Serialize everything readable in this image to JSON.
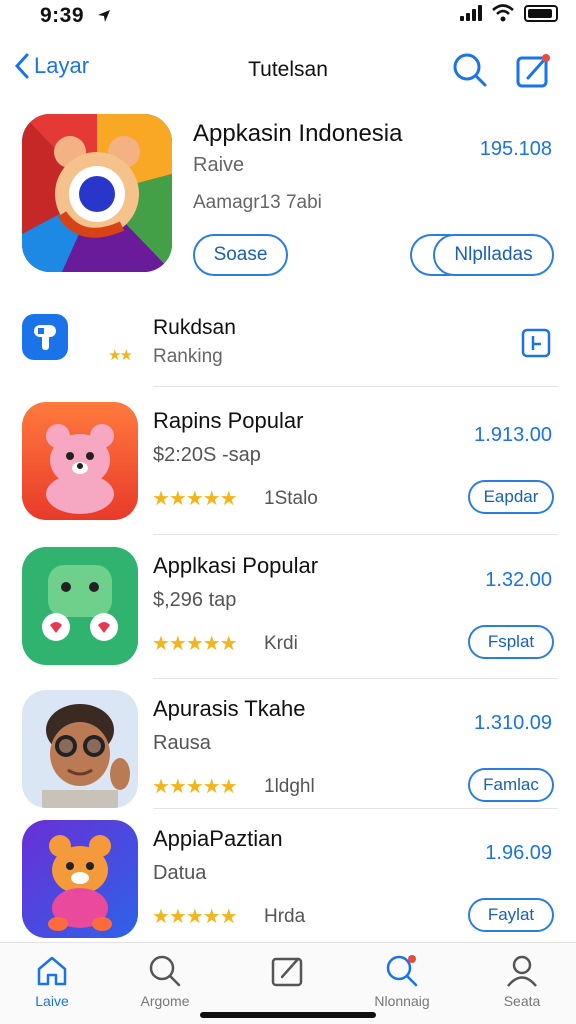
{
  "status_bar": {
    "time": "9:39"
  },
  "nav": {
    "back_label": "Layar",
    "title": "Tutelsan"
  },
  "hero": {
    "name": "Appkasin Indonesia",
    "subtitle": "Raive",
    "developer": "Aamagr13 7abi",
    "price": "195.108",
    "button_primary": "Soase",
    "button_secondary": "Nlplladas"
  },
  "ranking": {
    "title": "Rukdsan",
    "subtitle": "Ranking",
    "stars": "★★"
  },
  "apps": [
    {
      "name": "Rapins Popular",
      "subtitle": "$2:20S -sap",
      "stars": "★★★★★",
      "rating_text": "1Stalo",
      "price": "1.913.00",
      "button": "Eapdar"
    },
    {
      "name": "Applkasi Popular",
      "subtitle": "$,296 tap",
      "stars": "★★★★★",
      "rating_text": "Krdi",
      "price": "1.32.00",
      "button": "Fsplat"
    },
    {
      "name": "Apurasis Tkahe",
      "subtitle": "Rausa",
      "stars": "★★★★★",
      "rating_text": "1ldghl",
      "price": "1.310.09",
      "button": "Famlac"
    },
    {
      "name": "AppiaPaztian",
      "subtitle": "Datua",
      "stars": "★★★★★",
      "rating_text": "Hrda",
      "price": "1.96.09",
      "button": "Faylat"
    }
  ],
  "tabs": [
    {
      "label": "Laive",
      "icon": "home-icon",
      "active": true
    },
    {
      "label": "Argome",
      "icon": "search-icon",
      "active": false
    },
    {
      "label": "",
      "icon": "edit-icon",
      "active": false
    },
    {
      "label": "Nlonnaig",
      "icon": "search-badge-icon",
      "active": false
    },
    {
      "label": "Seata",
      "icon": "person-icon",
      "active": false
    }
  ],
  "colors": {
    "accent": "#1a73e8",
    "star": "#f3b51b"
  }
}
